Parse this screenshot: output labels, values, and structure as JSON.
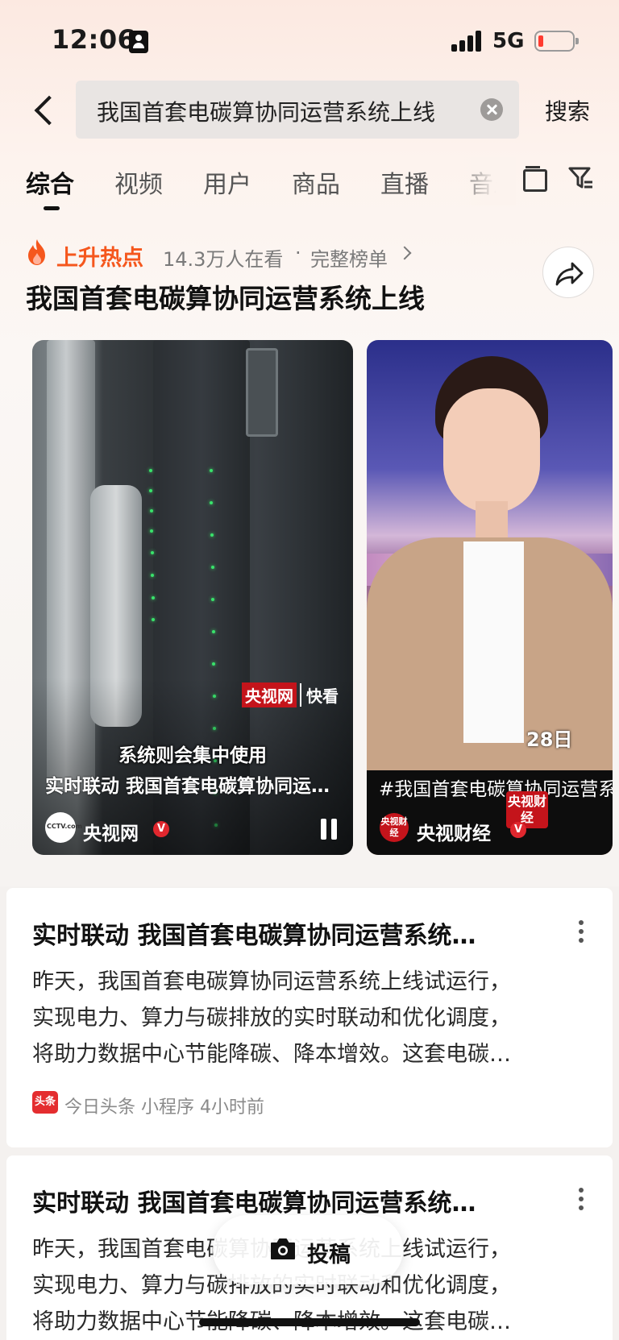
{
  "status_bar": {
    "time": "12:06",
    "network": "5G"
  },
  "search": {
    "query": "我国首套电碳算协同运营系统上线",
    "button_label": "搜索"
  },
  "tabs": [
    {
      "label": "综合",
      "active": true
    },
    {
      "label": "视频"
    },
    {
      "label": "用户"
    },
    {
      "label": "商品"
    },
    {
      "label": "直播"
    },
    {
      "label": "音乐"
    }
  ],
  "hot": {
    "label": "上升热点",
    "viewers": "14.3万人在看",
    "separator": "·",
    "full_list": "完整榜单",
    "title": "我国首套电碳算协同运营系统上线"
  },
  "videos": [
    {
      "watermark_red": "央视网",
      "watermark_white": "快看",
      "subtitle": "系统则会集中使用",
      "caption": "实时联动 我国首套电碳算协同运营系统上线",
      "source": "央视网",
      "avatar_text": "CCTV.com"
    },
    {
      "date_tag": "28日",
      "caption": "#我国首套电碳算协同运营系统上线",
      "source": "央视财经",
      "stamp": "央视财经",
      "avatar_text": "央视财经"
    }
  ],
  "articles": [
    {
      "title": "实时联动 我国首套电碳算协同运营系统…",
      "lines": [
        "昨天，我国首套电碳算协同运营系统上线试运行，",
        "实现电力、算力与碳排放的实时联动和优化调度，",
        "将助力数据中心节能降碳、降本增效。这套电碳…"
      ],
      "logo_text": "头条",
      "meta": "今日头条  小程序  4小时前"
    },
    {
      "title": "实时联动 我国首套电碳算协同运营系统…",
      "lines": [
        "昨天，我国首套电碳算协同运营系统上线试运行，",
        "实现电力、算力与碳排放的实时联动和优化调度，",
        "将助力数据中心节能降碳、降本增效。这套电碳…"
      ]
    }
  ],
  "post_button": {
    "label": "投稿"
  },
  "colors": {
    "accent_orange": "#f5571d",
    "brand_red": "#c4141b"
  }
}
